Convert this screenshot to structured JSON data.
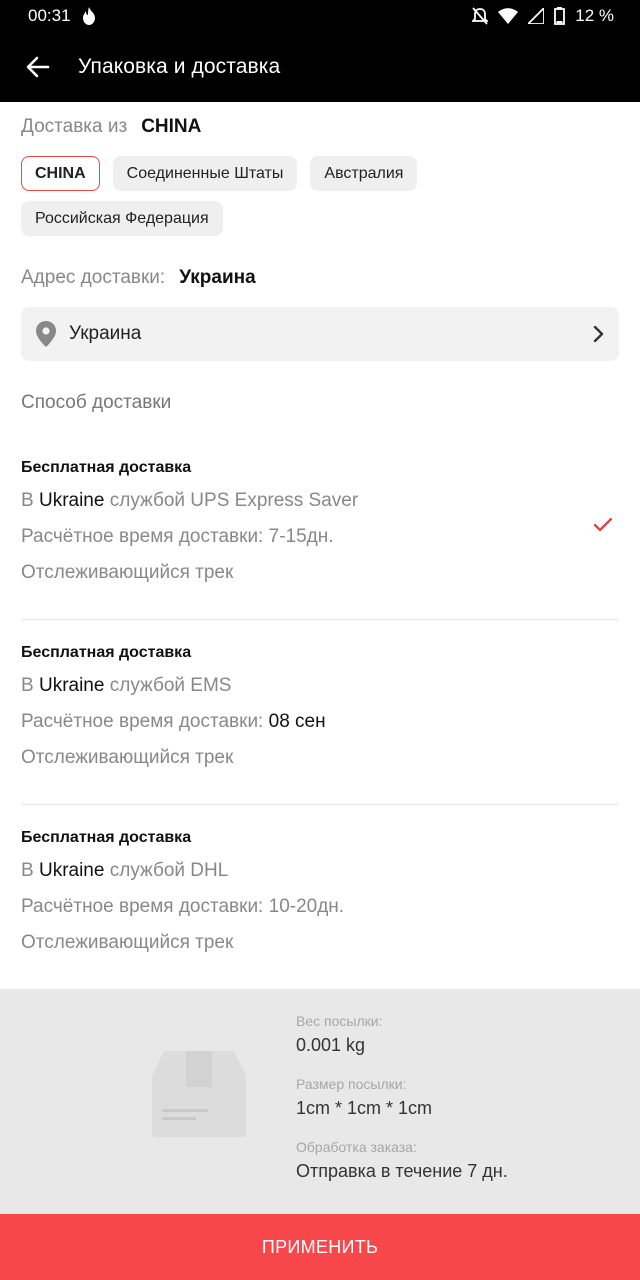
{
  "status_bar": {
    "time": "00:31",
    "battery_percent": "12 %",
    "icons": [
      "flame-icon",
      "mute-icon",
      "wifi-icon",
      "signal-icon",
      "battery-icon"
    ]
  },
  "app_bar": {
    "back_icon": "arrow-left-icon",
    "title": "Упаковка и доставка"
  },
  "delivery_from": {
    "label": "Доставка из",
    "value": "CHINA",
    "chips": [
      {
        "label": "CHINA",
        "active": true
      },
      {
        "label": "Соединенные Штаты",
        "active": false
      },
      {
        "label": "Австралия",
        "active": false
      },
      {
        "label": "Российская Федерация",
        "active": false
      }
    ]
  },
  "delivery_address": {
    "label": "Адрес доставки:",
    "value": "Украина",
    "selector_text": "Украина",
    "pin_icon": "location-pin-icon",
    "chevron_icon": "chevron-right-icon"
  },
  "method": {
    "label": "Способ доставки",
    "options": [
      {
        "title": "Бесплатная доставка",
        "prefix": "В",
        "country": "Ukraine",
        "service": "службой UPS Express Saver",
        "time_label": "Расчётное время доставки:",
        "time_value": "7-15дн.",
        "tracking": "Отслеживающийся трек",
        "selected": true
      },
      {
        "title": "Бесплатная доставка",
        "prefix": "В",
        "country": "Ukraine",
        "service": "службой EMS",
        "time_label": "Расчётное время доставки:",
        "time_value": "08 сен",
        "tracking": "Отслеживающийся трек",
        "selected": false
      },
      {
        "title": "Бесплатная доставка",
        "prefix": "В",
        "country": "Ukraine",
        "service": "службой DHL",
        "time_label": "Расчётное время доставки:",
        "time_value": "10-20дн.",
        "tracking": "Отслеживающийся трек",
        "selected": false
      }
    ]
  },
  "package": {
    "icon": "package-box-icon",
    "weight_label": "Вес посылки:",
    "weight_value": "0.001 kg",
    "size_label": "Размер посылки:",
    "size_value": "1cm * 1cm * 1cm",
    "processing_label": "Обработка заказа:",
    "processing_value": "Отправка в течение 7 дн."
  },
  "apply_button": "ПРИМЕНИТЬ",
  "colors": {
    "accent": "#f7474a",
    "appbar": "#000000",
    "check": "#e44444"
  }
}
